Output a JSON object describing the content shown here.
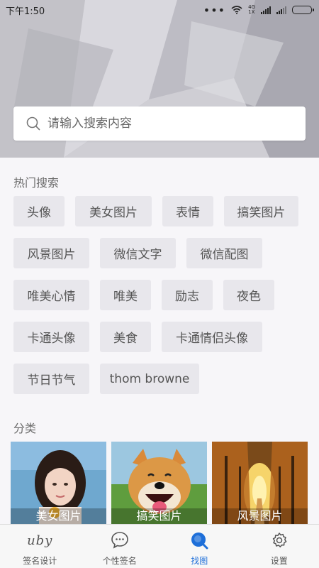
{
  "status_bar": {
    "time": "下午1:50",
    "network_label": "4G",
    "network_sub": "1X"
  },
  "search": {
    "placeholder": "请输入搜索内容"
  },
  "hot_search": {
    "title": "热门搜索",
    "rows": [
      [
        "头像",
        "美女图片",
        "表情",
        "搞笑图片"
      ],
      [
        "风景图片",
        "微信文字",
        "微信配图"
      ],
      [
        "唯美心情",
        "唯美",
        "励志",
        "夜色"
      ],
      [
        "卡通头像",
        "美食",
        "卡通情侣头像"
      ],
      [
        "节日节气",
        "thom browne"
      ]
    ]
  },
  "categories": {
    "title": "分类",
    "items": [
      {
        "label": "美女图片",
        "image": "portrait-girl"
      },
      {
        "label": "搞笑图片",
        "image": "smiling-dog"
      },
      {
        "label": "风景图片",
        "image": "autumn-road"
      }
    ]
  },
  "tabbar": {
    "items": [
      {
        "label": "签名设计",
        "icon": "signature-logo-icon",
        "logo_text": "uby",
        "active": false
      },
      {
        "label": "个性签名",
        "icon": "chat-bubble-icon",
        "active": false
      },
      {
        "label": "找图",
        "icon": "search-circle-icon",
        "active": true
      },
      {
        "label": "设置",
        "icon": "gear-icon",
        "active": false
      }
    ]
  },
  "colors": {
    "accent": "#1e6fd9",
    "tag_bg": "#e8e7ec",
    "page_bg": "#f7f6f9"
  }
}
